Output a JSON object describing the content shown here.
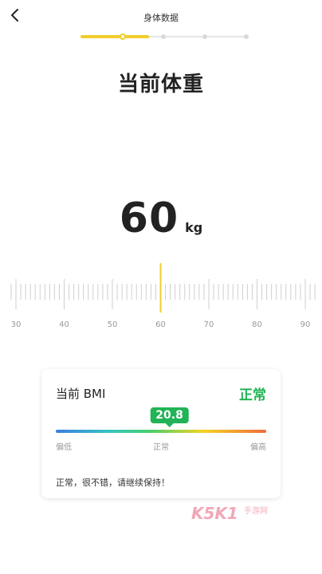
{
  "header": {
    "title": "身体数据",
    "back_icon": "chevron-left-icon"
  },
  "progress": {
    "steps": 5,
    "current_step": 2,
    "fill_fraction": 0.41,
    "accent": "#f2cd2c",
    "track": "#e6e6e6"
  },
  "page": {
    "heading": "当前体重"
  },
  "weight": {
    "value": "60",
    "unit": "kg"
  },
  "ruler": {
    "labels": [
      "30",
      "40",
      "50",
      "60",
      "70",
      "80",
      "90"
    ],
    "min": 30,
    "max": 90,
    "selected": 60,
    "indicator_color": "#f2cd2c"
  },
  "bmi_card": {
    "title": "当前 BMI",
    "status": "正常",
    "status_color": "#22b356",
    "value": "20.8",
    "value_fraction": 0.54,
    "labels": {
      "low": "偏低",
      "normal": "正常",
      "high": "偏高"
    },
    "message": "正常，很不错，请继续保持！"
  },
  "watermark": {
    "text": "K5K1",
    "sub": "手游网"
  }
}
